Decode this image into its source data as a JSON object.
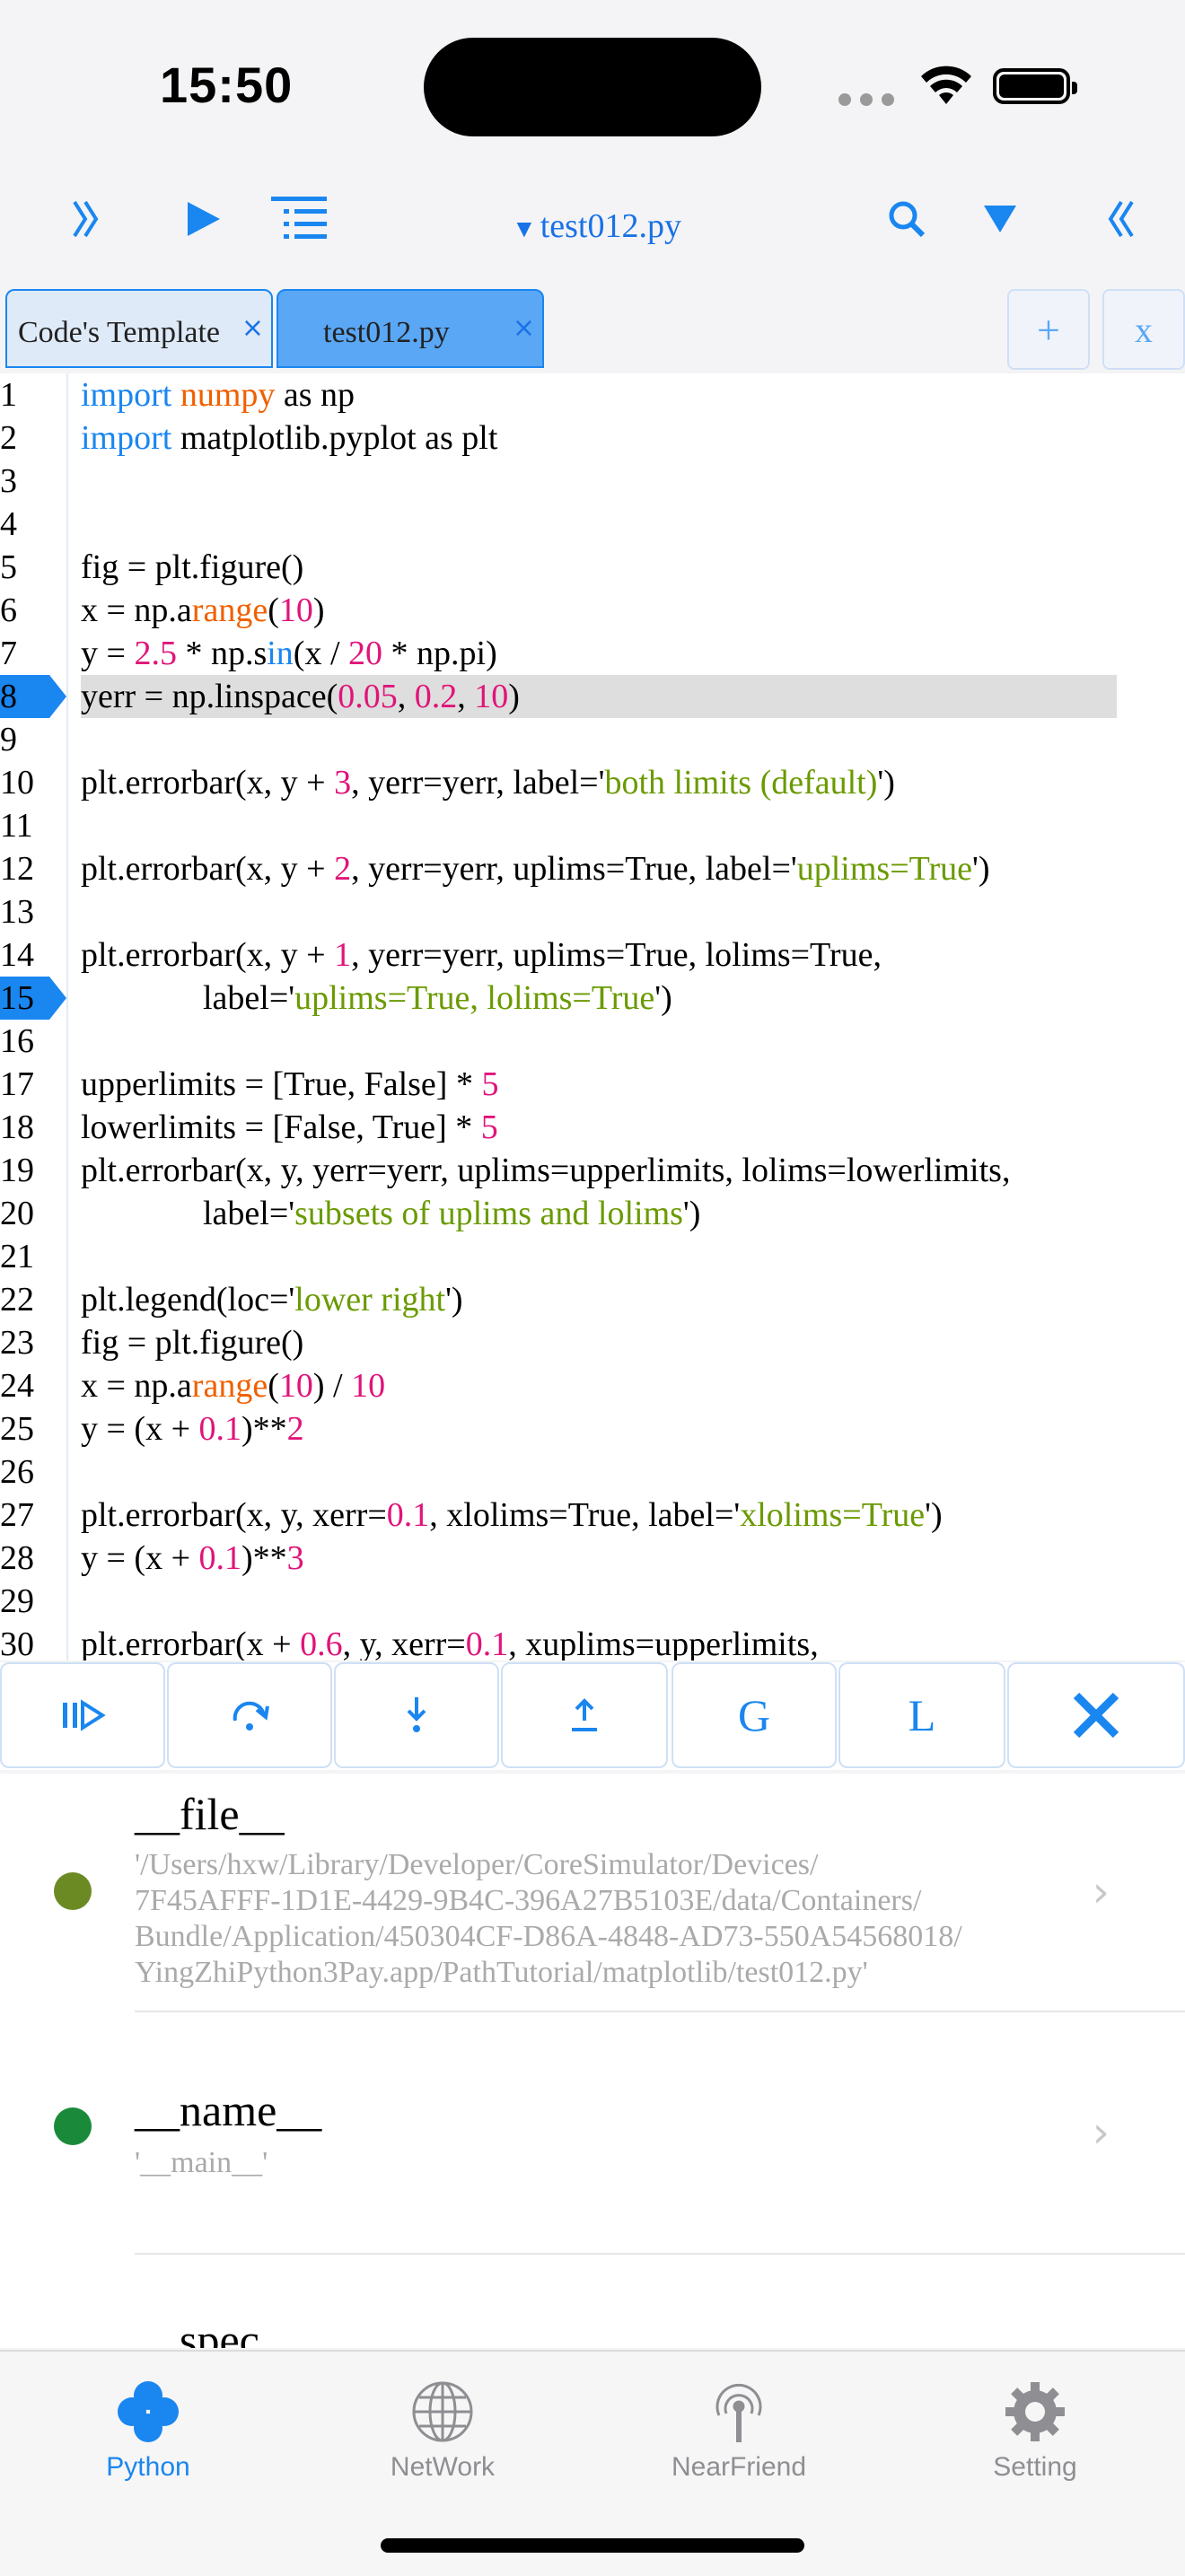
{
  "status": {
    "time": "15:50"
  },
  "toolbar": {
    "collapse_icon": "double-chevron-right",
    "run_icon": "play",
    "outline_icon": "list",
    "file_title": "test012.py",
    "search_icon": "magnifier",
    "filter_icon": "down-triangle",
    "expand_icon": "double-chevron-left"
  },
  "tabs": {
    "items": [
      {
        "label": "Code's Template",
        "close": "×"
      },
      {
        "label": "test012.py",
        "close": "×"
      }
    ],
    "add_label": "+",
    "close_all_label": "x"
  },
  "editor": {
    "highlighted_line": 8,
    "breakpoints": [
      8,
      15
    ],
    "lines": [
      {
        "n": "1",
        "t": [
          [
            "kw",
            "import"
          ],
          [
            "p",
            " "
          ],
          [
            "mod",
            "numpy"
          ],
          [
            "p",
            " as np"
          ]
        ]
      },
      {
        "n": "2",
        "t": [
          [
            "kw",
            "import"
          ],
          [
            "p",
            " matplotlib.pyplot as plt"
          ]
        ]
      },
      {
        "n": "3",
        "t": []
      },
      {
        "n": "4",
        "t": []
      },
      {
        "n": "5",
        "t": [
          [
            "p",
            "fig = plt.figure()"
          ]
        ]
      },
      {
        "n": "6",
        "t": [
          [
            "p",
            "x = np.a"
          ],
          [
            "mod",
            "range"
          ],
          [
            "p",
            "("
          ],
          [
            "num",
            "10"
          ],
          [
            "p",
            ")"
          ]
        ]
      },
      {
        "n": "7",
        "t": [
          [
            "p",
            "y = "
          ],
          [
            "num",
            "2.5"
          ],
          [
            "p",
            " * np.s"
          ],
          [
            "kw",
            "in"
          ],
          [
            "p",
            "(x / "
          ],
          [
            "num",
            "20"
          ],
          [
            "p",
            " * np.pi)"
          ]
        ]
      },
      {
        "n": "8",
        "t": [
          [
            "p",
            "yerr = np.linspace("
          ],
          [
            "num",
            "0.05"
          ],
          [
            "p",
            ", "
          ],
          [
            "num",
            "0.2"
          ],
          [
            "p",
            ", "
          ],
          [
            "num",
            "10"
          ],
          [
            "p",
            ")"
          ]
        ]
      },
      {
        "n": "9",
        "t": []
      },
      {
        "n": "10",
        "t": [
          [
            "p",
            "plt.errorbar(x, y + "
          ],
          [
            "num",
            "3"
          ],
          [
            "p",
            ", yerr=yerr, label='"
          ],
          [
            "str",
            "both limits (default)"
          ],
          [
            "p",
            "')"
          ]
        ]
      },
      {
        "n": "11",
        "t": []
      },
      {
        "n": "12",
        "t": [
          [
            "p",
            "plt.errorbar(x, y + "
          ],
          [
            "num",
            "2"
          ],
          [
            "p",
            ", yerr=yerr, uplims=True, label='"
          ],
          [
            "str",
            "uplims=True"
          ],
          [
            "p",
            "')"
          ]
        ]
      },
      {
        "n": "13",
        "t": []
      },
      {
        "n": "14",
        "t": [
          [
            "p",
            "plt.errorbar(x, y + "
          ],
          [
            "num",
            "1"
          ],
          [
            "p",
            ", yerr=yerr, uplims=True, lolims=True,"
          ]
        ]
      },
      {
        "n": "15",
        "indent": true,
        "t": [
          [
            "p",
            "label='"
          ],
          [
            "str",
            "uplims=True, lolims=True"
          ],
          [
            "p",
            "')"
          ]
        ]
      },
      {
        "n": "16",
        "t": []
      },
      {
        "n": "17",
        "t": [
          [
            "p",
            "upperlimits = [True, False] * "
          ],
          [
            "num",
            "5"
          ]
        ]
      },
      {
        "n": "18",
        "t": [
          [
            "p",
            "lowerlimits = [False, True] * "
          ],
          [
            "num",
            "5"
          ]
        ]
      },
      {
        "n": "19",
        "t": [
          [
            "p",
            "plt.errorbar(x, y, yerr=yerr, uplims=upperlimits, lolims=lowerlimits,"
          ]
        ]
      },
      {
        "n": "20",
        "indent": true,
        "t": [
          [
            "p",
            "label='"
          ],
          [
            "str",
            "subsets of uplims and lolims"
          ],
          [
            "p",
            "')"
          ]
        ]
      },
      {
        "n": "21",
        "t": []
      },
      {
        "n": "22",
        "t": [
          [
            "p",
            "plt.legend(loc='"
          ],
          [
            "str",
            "lower right"
          ],
          [
            "p",
            "')"
          ]
        ]
      },
      {
        "n": "23",
        "t": [
          [
            "p",
            "fig = plt.figure()"
          ]
        ]
      },
      {
        "n": "24",
        "t": [
          [
            "p",
            "x = np.a"
          ],
          [
            "mod",
            "range"
          ],
          [
            "p",
            "("
          ],
          [
            "num",
            "10"
          ],
          [
            "p",
            ") / "
          ],
          [
            "num",
            "10"
          ]
        ]
      },
      {
        "n": "25",
        "t": [
          [
            "p",
            "y = (x + "
          ],
          [
            "num",
            "0.1"
          ],
          [
            "p",
            ")**"
          ],
          [
            "num",
            "2"
          ]
        ]
      },
      {
        "n": "26",
        "t": []
      },
      {
        "n": "27",
        "t": [
          [
            "p",
            "plt.errorbar(x, y, xerr="
          ],
          [
            "num",
            "0.1"
          ],
          [
            "p",
            ", xlolims=True, label='"
          ],
          [
            "str",
            "xlolims=True"
          ],
          [
            "p",
            "')"
          ]
        ]
      },
      {
        "n": "28",
        "t": [
          [
            "p",
            "y = (x + "
          ],
          [
            "num",
            "0.1"
          ],
          [
            "p",
            ")**"
          ],
          [
            "num",
            "3"
          ]
        ]
      },
      {
        "n": "29",
        "t": []
      },
      {
        "n": "30",
        "t": [
          [
            "p",
            "plt.errorbar(x + "
          ],
          [
            "num",
            "0.6"
          ],
          [
            "p",
            ", y, xerr="
          ],
          [
            "num",
            "0.1"
          ],
          [
            "p",
            ", xuplims=upperlimits,"
          ]
        ]
      }
    ]
  },
  "debug": {
    "continue_icon": "step-continue",
    "step_over_icon": "step-over",
    "step_into_icon": "step-into",
    "step_out_icon": "step-out",
    "globals_label": "G",
    "locals_label": "L",
    "close_icon": "close-x"
  },
  "variables": [
    {
      "name": "__file__",
      "value": "'/Users/hxw/Library/Developer/CoreSimulator/Devices/\n7F45AFFF-1D1E-4429-9B4C-396A27B5103E/data/Containers/\nBundle/Application/450304CF-D86A-4848-AD73-550A54568018/\nYingZhiPython3Pay.app/PathTutorial/matplotlib/test012.py'",
      "color": "#6b8a24"
    },
    {
      "name": "__name__",
      "value": "'__main__'",
      "color": "#1a8a3a"
    },
    {
      "name": "__spec__",
      "value": "",
      "color": "#1a8a3a"
    }
  ],
  "tabbar": {
    "items": [
      {
        "label": "Python",
        "icon": "python-clover"
      },
      {
        "label": "NetWork",
        "icon": "globe"
      },
      {
        "label": "NearFriend",
        "icon": "antenna"
      },
      {
        "label": "Setting",
        "icon": "gear"
      }
    ]
  },
  "colors": {
    "accent": "#1a86f0",
    "keyword": "#1a86f0",
    "module": "#f06000",
    "number": "#e0147a",
    "string": "#6a9a00"
  }
}
